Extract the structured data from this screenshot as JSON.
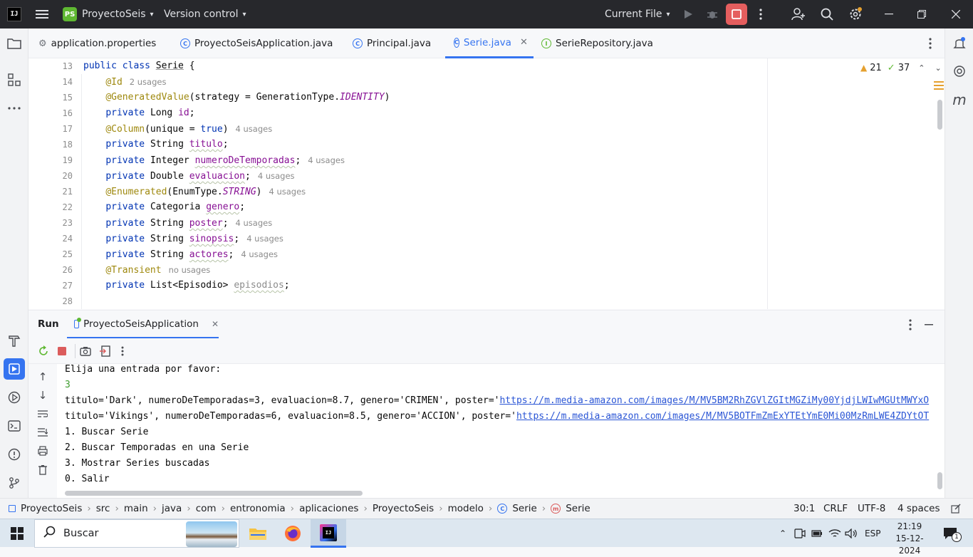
{
  "title_bar": {
    "project_badge": "PS",
    "project_name": "ProyectoSeis",
    "vcs_label": "Version control",
    "run_config": "Current File"
  },
  "tabs": [
    {
      "label": "application.properties"
    },
    {
      "label": "ProyectoSeisApplication.java"
    },
    {
      "label": "Principal.java"
    },
    {
      "label": "Serie.java"
    },
    {
      "label": "SerieRepository.java"
    }
  ],
  "inspections": {
    "warnings": "21",
    "ok": "37"
  },
  "editor": {
    "line_numbers": [
      "13",
      "14",
      "15",
      "16",
      "17",
      "18",
      "19",
      "20",
      "21",
      "22",
      "23",
      "24",
      "25",
      "26",
      "27",
      "28"
    ],
    "usages": {
      "id": "2 usages",
      "unique": "4 usages",
      "numero": "4 usages",
      "evaluacion": "4 usages",
      "enumerated": "4 usages",
      "poster": "4 usages",
      "sinopsis": "4 usages",
      "actores": "4 usages",
      "transient": "no usages"
    }
  },
  "run_panel": {
    "tab_run": "Run",
    "tab_app": "ProyectoSeisApplication",
    "console": [
      "Elija una entrada por favor:",
      "3",
      "titulo='Dark', numeroDeTemporadas=3, evaluacion=8.7, genero='CRIMEN', poster='",
      "https://m.media-amazon.com/images/M/MV5BM2RhZGVlZGItMGZiMy00YjdjLWIwMGUtMWYxO",
      "titulo='Vikings', numeroDeTemporadas=6, evaluacion=8.5, genero='ACCION', poster='",
      "https://m.media-amazon.com/images/M/MV5BOTFmZmExYTEtYmE0Mi00MzRmLWE4ZDYtOT",
      "1. Buscar Serie",
      "2. Buscar Temporadas en una Serie",
      "3. Mostrar Series buscadas",
      "0. Salir"
    ]
  },
  "statusbar": {
    "breadcrumb": [
      "ProyectoSeis",
      "src",
      "main",
      "java",
      "com",
      "entronomia",
      "aplicaciones",
      "ProyectoSeis",
      "modelo",
      "Serie",
      "Serie"
    ],
    "position": "30:1",
    "line_sep": "CRLF",
    "encoding": "UTF-8",
    "indent": "4 spaces"
  },
  "taskbar": {
    "search_placeholder": "Buscar",
    "lang": "ESP",
    "time": "21:19",
    "date": "15-12-2024",
    "notif_count": "1"
  },
  "colors": {
    "accent": "#3574f0",
    "stop": "#e55e5e",
    "titlebar": "#27282c"
  }
}
